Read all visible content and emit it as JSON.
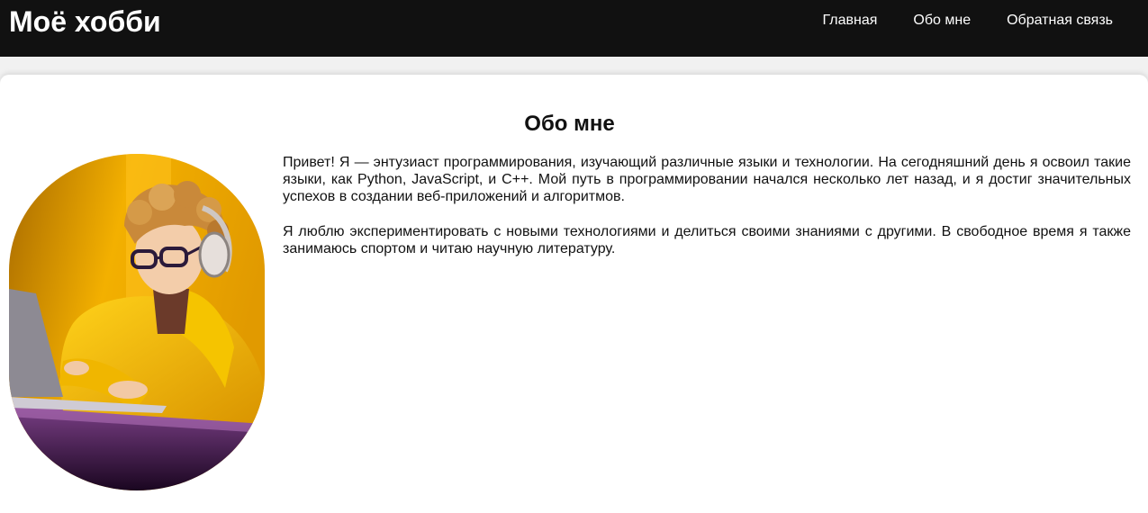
{
  "header": {
    "title": "Моё хобби",
    "nav": [
      {
        "label": "Главная"
      },
      {
        "label": "Обо мне"
      },
      {
        "label": "Обратная связь"
      }
    ]
  },
  "main": {
    "section_title": "Обо мне",
    "paragraphs": [
      "Привет! Я — энтузиаст программирования, изучающий различные языки и технологии. На сегодняшний день я освоил такие языки, как Python, JavaScript, и C++. Мой путь в программировании начался несколько лет назад, и я достиг значительных успехов в создании веб-приложений и алгоритмов.",
      "Я люблю экспериментировать с новыми технологиями и делиться своими знаниями с другими. В свободное время я также занимаюсь спортом и читаю научную литературу."
    ],
    "photo_description_icon": "portrait-photo"
  },
  "colors": {
    "header_bg": "#111111",
    "page_bg": "#f1f1f1",
    "card_bg": "#ffffff",
    "accent_yellow": "#f2b705"
  }
}
